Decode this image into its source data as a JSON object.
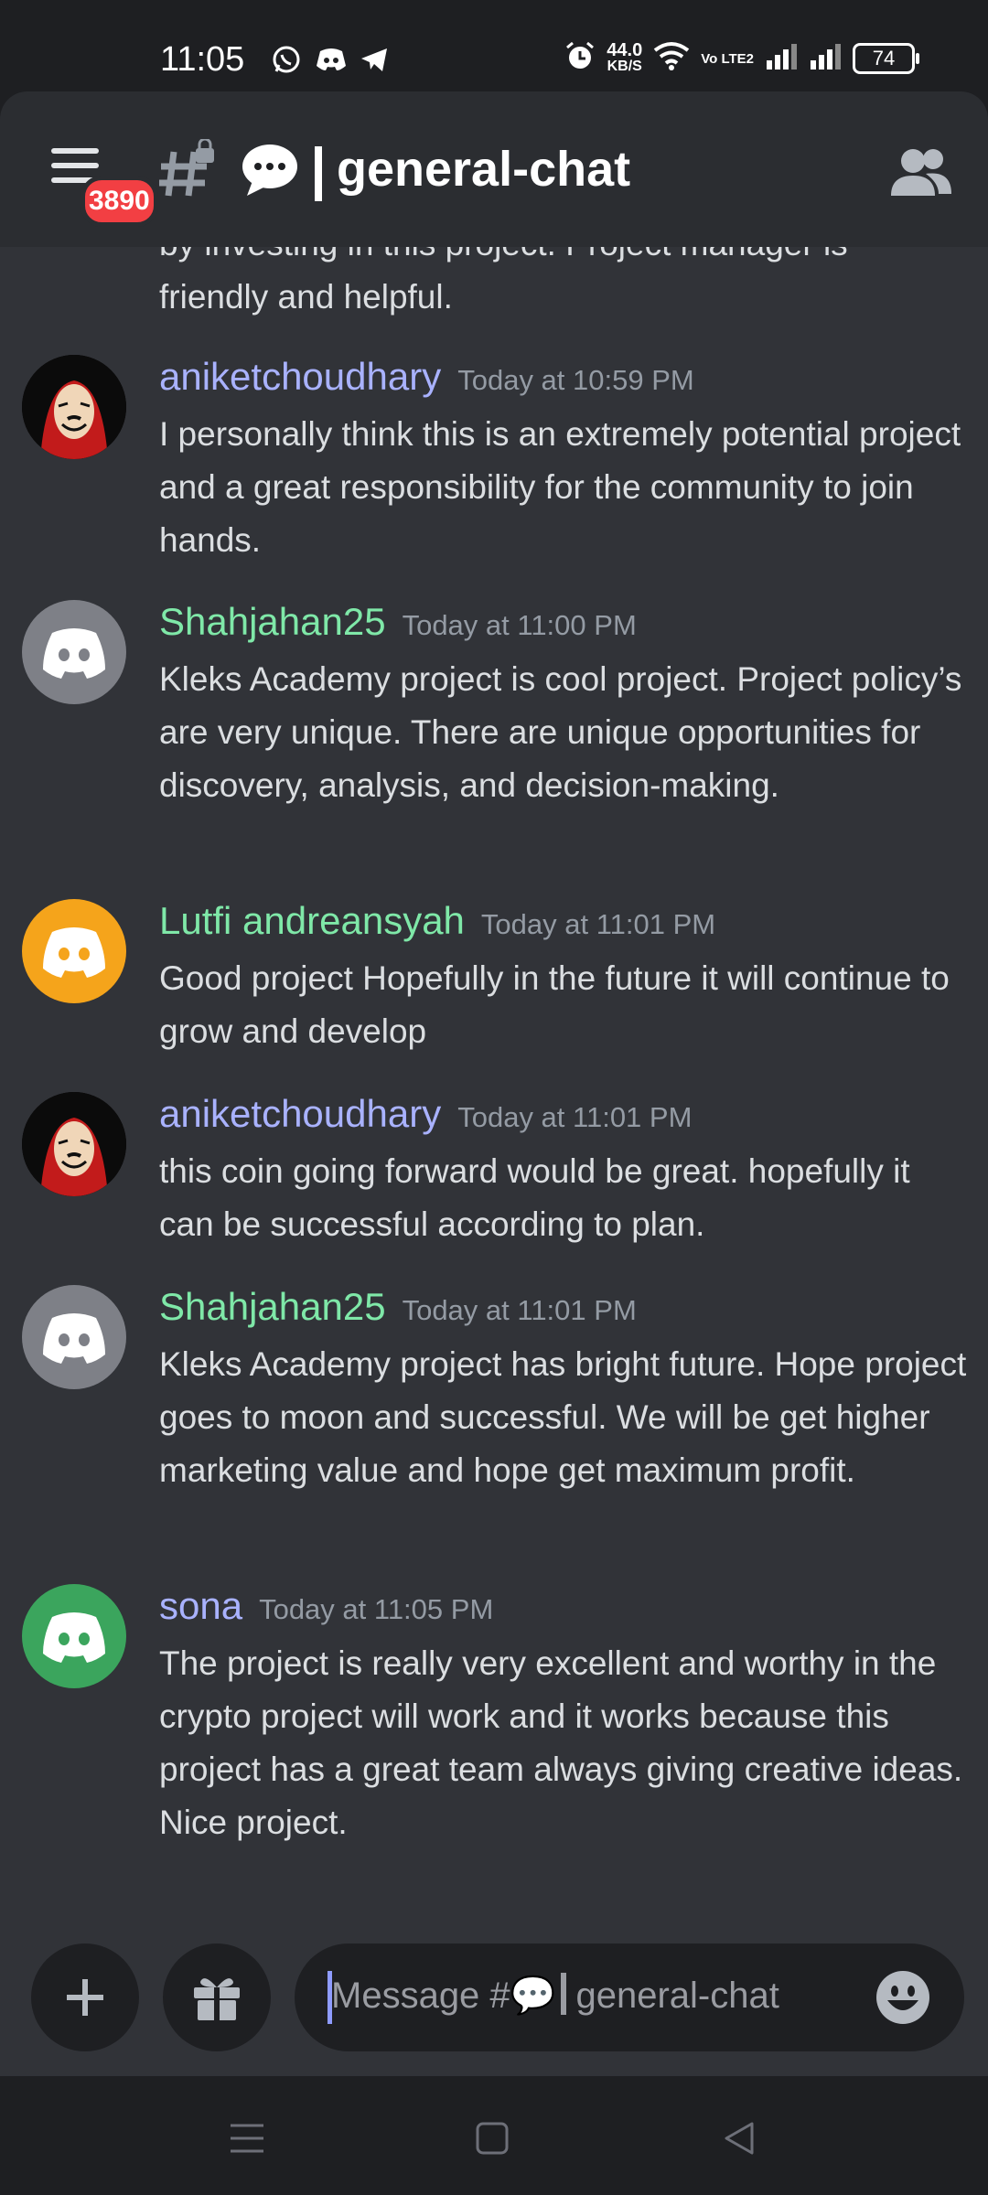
{
  "status_bar": {
    "time": "11:05",
    "net_speed": "44.0",
    "net_unit": "KB/S",
    "volte": "Vo LTE2",
    "battery": "74"
  },
  "header": {
    "unread_badge": "3890",
    "channel_emoji": "💬",
    "channel_name": "general-chat",
    "icons": [
      "menu-icon",
      "locked-hash-icon",
      "members-icon"
    ]
  },
  "messages": {
    "lead_continuation": "by investing in this project. Project manager is friendly and helpful.",
    "items": [
      {
        "author": "aniketchoudhary",
        "author_color": "#a9b2ff",
        "avatar": "mask-avatar",
        "avatar_color": "#000000",
        "timestamp": "Today at 10:59 PM",
        "text": "I personally think this is an extremely potential project and a great responsibility for the community to join hands."
      },
      {
        "author": "Shahjahan25",
        "author_color": "#7fe8a8",
        "avatar": "discord-icon",
        "avatar_color": "#7e8087",
        "timestamp": "Today at 11:00 PM",
        "text": "Kleks Academy project is cool project. Project policy’s are very unique. There are unique opportunities for discovery, analysis, and decision-making."
      },
      {
        "author": "Lutfi andreansyah",
        "author_color": "#7fe8a8",
        "avatar": "discord-icon",
        "avatar_color": "#f5a41b",
        "timestamp": "Today at 11:01 PM",
        "text": "Good project Hopefully in the future it will continue to grow and develop"
      },
      {
        "author": "aniketchoudhary",
        "author_color": "#a9b2ff",
        "avatar": "mask-avatar",
        "avatar_color": "#000000",
        "timestamp": "Today at 11:01 PM",
        "text": "this coin going forward would be great. hopefully it can be successful according to plan."
      },
      {
        "author": "Shahjahan25",
        "author_color": "#7fe8a8",
        "avatar": "discord-icon",
        "avatar_color": "#7e8087",
        "timestamp": "Today at 11:01 PM",
        "text": "Kleks Academy project has bright future. Hope project goes to moon and successful.  We will be get higher marketing value and hope get maximum profit."
      },
      {
        "author": "sona",
        "author_color": "#a9b2ff",
        "avatar": "discord-icon",
        "avatar_color": "#3ba55d",
        "timestamp": "Today at 11:05 PM",
        "text": "The project is really very excellent and worthy in the crypto  project will work and it works because this project has a great team always giving creative ideas. Nice project."
      }
    ]
  },
  "composer": {
    "placeholder_prefix": "Message #",
    "placeholder_emoji": "💬",
    "placeholder_channel": "general-chat"
  }
}
